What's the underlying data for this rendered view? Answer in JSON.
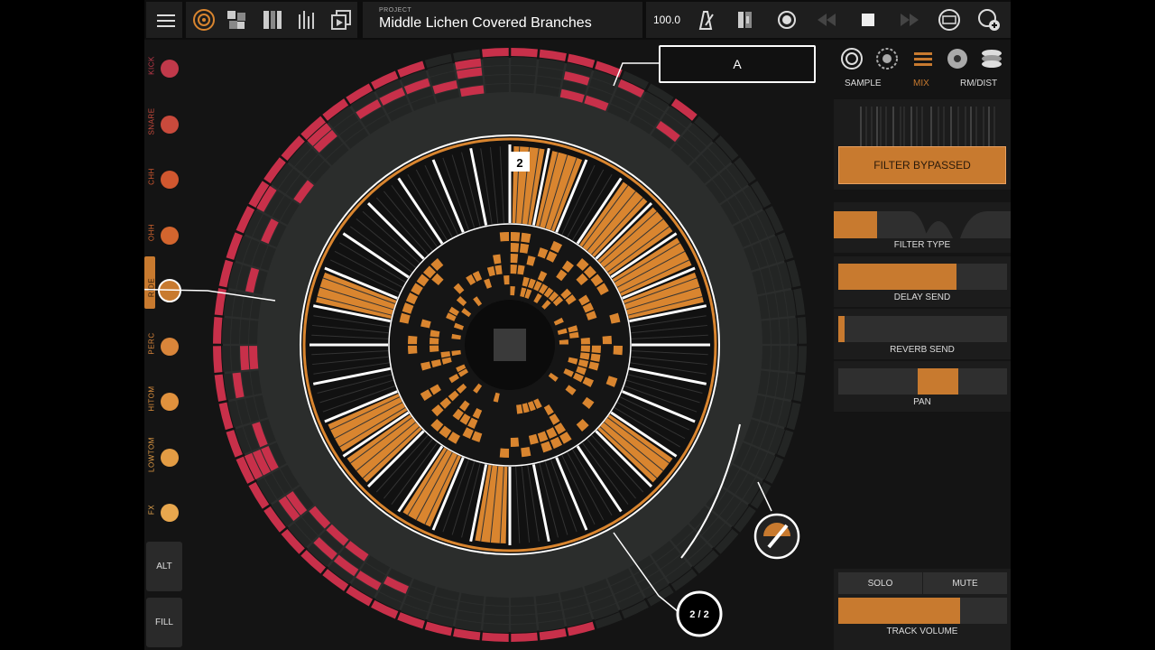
{
  "toolbar": {
    "project_caption": "PROJECT",
    "project_name": "Middle Lichen Covered Branches",
    "tempo": "100.0",
    "icons": [
      "menu-icon",
      "rings-icon",
      "patterns-icon",
      "song-icon",
      "mixer-icon",
      "export-icon",
      "metronome-icon",
      "count-in-icon",
      "record-icon",
      "rewind-icon",
      "stop-icon",
      "forward-icon",
      "link-icon",
      "add-device-icon"
    ]
  },
  "tracks": [
    {
      "label": "KICK",
      "color": "#c0394a"
    },
    {
      "label": "SNARE",
      "color": "#c94a3c"
    },
    {
      "label": "CHH",
      "color": "#d0572f"
    },
    {
      "label": "OHH",
      "color": "#d3652e"
    },
    {
      "label": "RIDE",
      "color": "#c87a2f",
      "selected": true
    },
    {
      "label": "PERC",
      "color": "#d9853a"
    },
    {
      "label": "HITOM",
      "color": "#e0913d"
    },
    {
      "label": "LOWTOM",
      "color": "#e39c44"
    },
    {
      "label": "FX",
      "color": "#e8a74e"
    }
  ],
  "left_buttons": {
    "alt": "ALT",
    "fill": "FILL"
  },
  "sequencer": {
    "pattern_name": "A",
    "page_indicator": "2 / 2",
    "playhead_step": "2",
    "colors": {
      "outer": "#c8304a",
      "mid": "#c8602f",
      "orange": "#d9852f",
      "dark": "#222523"
    }
  },
  "right_panel": {
    "tabs": [
      {
        "label": "SAMPLE",
        "active": false
      },
      {
        "label": "MIX",
        "active": true
      },
      {
        "label": "RM/DIST",
        "active": false
      }
    ],
    "filter_bypass_label": "FILTER BYPASSED",
    "filter_type_label": "FILTER TYPE",
    "filter_type_selected": 0,
    "delay_send_label": "DELAY SEND",
    "delay_send": 0.7,
    "reverb_send_label": "REVERB SEND",
    "reverb_send": 0.04,
    "pan_label": "PAN",
    "pan": 0.55,
    "solo_label": "SOLO",
    "mute_label": "MUTE",
    "track_volume_label": "TRACK VOLUME",
    "track_volume": 0.72
  }
}
